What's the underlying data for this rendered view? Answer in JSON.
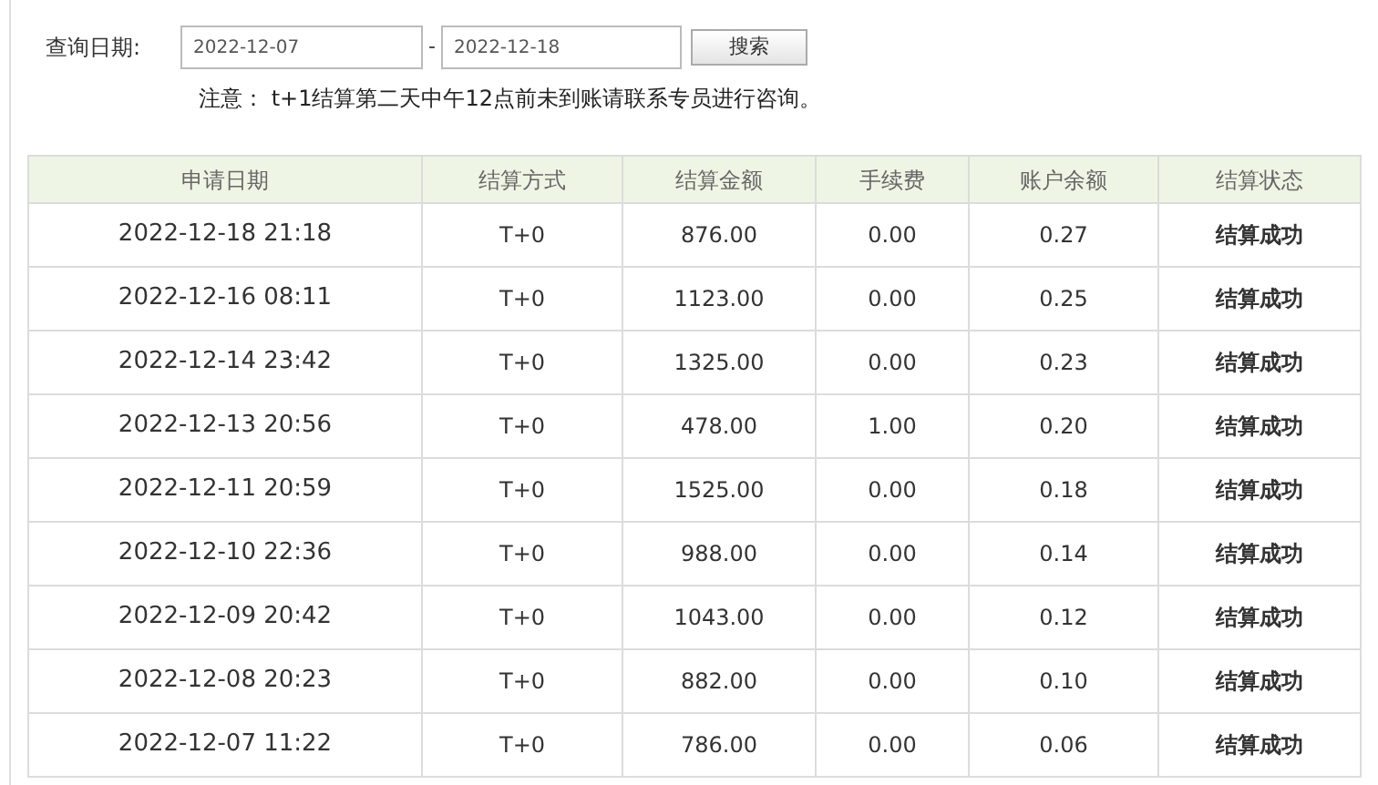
{
  "query": {
    "label": "查询日期:",
    "start_date": "2022-12-07",
    "separator": "-",
    "end_date": "2022-12-18",
    "search_button": "搜索"
  },
  "notice": "注意： t+1结算第二天中午12点前未到账请联系专员进行咨询。",
  "table": {
    "columns": [
      "申请日期",
      "结算方式",
      "结算金额",
      "手续费",
      "账户余额",
      "结算状态"
    ],
    "rows": [
      [
        "2022-12-18 21:18",
        "T+0",
        "876.00",
        "0.00",
        "0.27",
        "结算成功"
      ],
      [
        "2022-12-16 08:11",
        "T+0",
        "1123.00",
        "0.00",
        "0.25",
        "结算成功"
      ],
      [
        "2022-12-14 23:42",
        "T+0",
        "1325.00",
        "0.00",
        "0.23",
        "结算成功"
      ],
      [
        "2022-12-13 20:56",
        "T+0",
        "478.00",
        "1.00",
        "0.20",
        "结算成功"
      ],
      [
        "2022-12-11 20:59",
        "T+0",
        "1525.00",
        "0.00",
        "0.18",
        "结算成功"
      ],
      [
        "2022-12-10 22:36",
        "T+0",
        "988.00",
        "0.00",
        "0.14",
        "结算成功"
      ],
      [
        "2022-12-09 20:42",
        "T+0",
        "1043.00",
        "0.00",
        "0.12",
        "结算成功"
      ],
      [
        "2022-12-08 20:23",
        "T+0",
        "882.00",
        "0.00",
        "0.10",
        "结算成功"
      ],
      [
        "2022-12-07 11:22",
        "T+0",
        "786.00",
        "0.00",
        "0.06",
        "结算成功"
      ]
    ]
  }
}
